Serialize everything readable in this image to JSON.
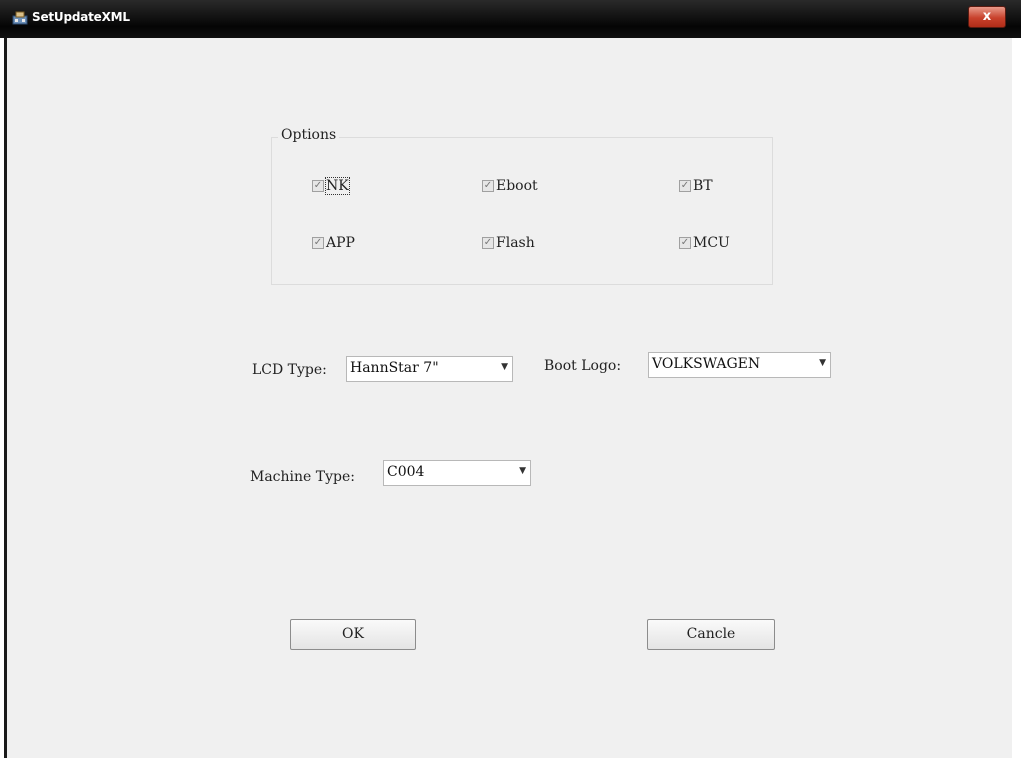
{
  "window": {
    "title": "SetUpdateXML",
    "close_label": "x"
  },
  "options": {
    "group_label": "Options",
    "items": [
      {
        "label": "NK",
        "checked": true
      },
      {
        "label": "Eboot",
        "checked": true
      },
      {
        "label": "BT",
        "checked": true
      },
      {
        "label": "APP",
        "checked": true
      },
      {
        "label": "Flash",
        "checked": true
      },
      {
        "label": "MCU",
        "checked": true
      }
    ]
  },
  "lcd_type": {
    "label": "LCD Type:",
    "value": "HannStar 7\""
  },
  "boot_logo": {
    "label": "Boot Logo:",
    "value": "VOLKSWAGEN"
  },
  "machine_type": {
    "label": "Machine Type:",
    "value": "C004"
  },
  "buttons": {
    "ok": "OK",
    "cancel": "Cancle"
  },
  "icons": {
    "check": "✓",
    "dropdown": "▼"
  }
}
